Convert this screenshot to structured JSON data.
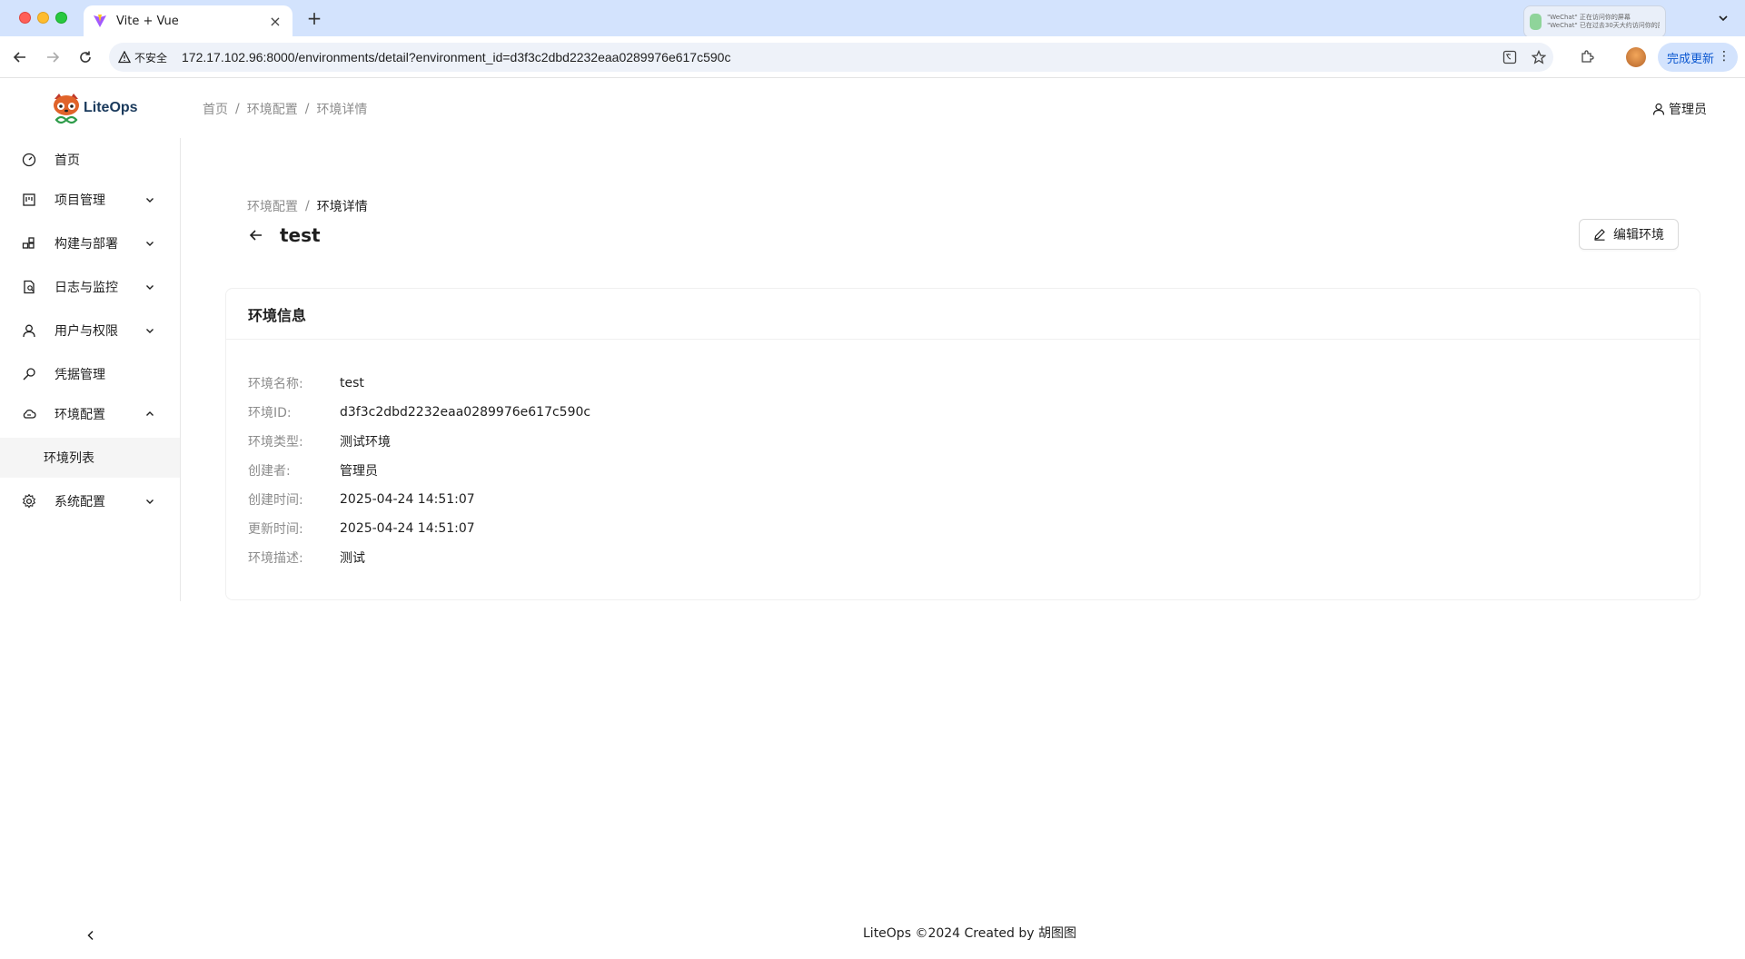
{
  "browser": {
    "tab_title": "Vite + Vue",
    "insecure_label": "不安全",
    "url": "172.17.102.96:8000/environments/detail?environment_id=d3f3c2dbd2232eaa0289976e617c590c",
    "update_label": "完成更新",
    "notification_title": "\"WeChat\" 正在访问你的屏幕",
    "notification_body": "\"WeChat\" 已在过去30天大约访问你的屏幕和系统音频"
  },
  "app": {
    "logo_text": "LiteOps",
    "header_breadcrumb": [
      "首页",
      "环境配置",
      "环境详情"
    ],
    "user_name": "管理员"
  },
  "sidebar": {
    "items": [
      {
        "label": "首页",
        "icon": "dashboard-icon"
      },
      {
        "label": "项目管理",
        "icon": "project-icon"
      },
      {
        "label": "构建与部署",
        "icon": "build-icon"
      },
      {
        "label": "日志与监控",
        "icon": "log-icon"
      },
      {
        "label": "用户与权限",
        "icon": "user-icon"
      },
      {
        "label": "凭据管理",
        "icon": "key-icon"
      },
      {
        "label": "环境配置",
        "icon": "cloud-icon"
      },
      {
        "label": "系统配置",
        "icon": "gear-icon"
      }
    ],
    "subitems": [
      {
        "label": "环境列表"
      }
    ]
  },
  "page": {
    "breadcrumb": [
      "环境配置",
      "环境详情"
    ],
    "title": "test",
    "edit_label": "编辑环境",
    "card_title": "环境信息",
    "fields": [
      {
        "label": "环境名称:",
        "value": "test"
      },
      {
        "label": "环境ID:",
        "value": "d3f3c2dbd2232eaa0289976e617c590c"
      },
      {
        "label": "环境类型:",
        "value": "测试环境"
      },
      {
        "label": "创建者:",
        "value": "管理员"
      },
      {
        "label": "创建时间:",
        "value": "2025-04-24 14:51:07"
      },
      {
        "label": "更新时间:",
        "value": "2025-04-24 14:51:07"
      },
      {
        "label": "环境描述:",
        "value": "测试"
      }
    ]
  },
  "footer": {
    "text": "LiteOps ©2024 Created by 胡图图"
  }
}
